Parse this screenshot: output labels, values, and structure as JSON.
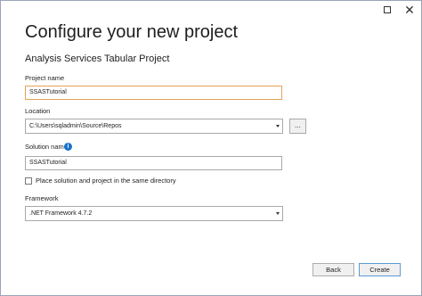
{
  "window": {
    "title": "Configure your new project",
    "subtitle": "Analysis Services Tabular Project"
  },
  "fields": {
    "project_name": {
      "label": "Project name",
      "value": "SSASTutorial"
    },
    "location": {
      "label": "Location",
      "value": "C:\\Users\\sqladmin\\Source\\Repos",
      "browse_label": "..."
    },
    "solution_name": {
      "label": "Solution name",
      "value": "SSASTutorial",
      "info_glyph": "i"
    },
    "same_directory": {
      "label": "Place solution and project in the same directory",
      "checked": false
    },
    "framework": {
      "label": "Framework",
      "value": ".NET Framework 4.7.2"
    }
  },
  "footer": {
    "back_label": "Back",
    "create_label": "Create"
  },
  "icons": {
    "maximize": "maximize-icon",
    "close": "close-icon",
    "info": "info-icon",
    "dropdown": "chevron-down-icon"
  },
  "colors": {
    "focus_border": "#e4a25a",
    "info_blue": "#1a73c9",
    "primary_border": "#5b9bd5"
  }
}
